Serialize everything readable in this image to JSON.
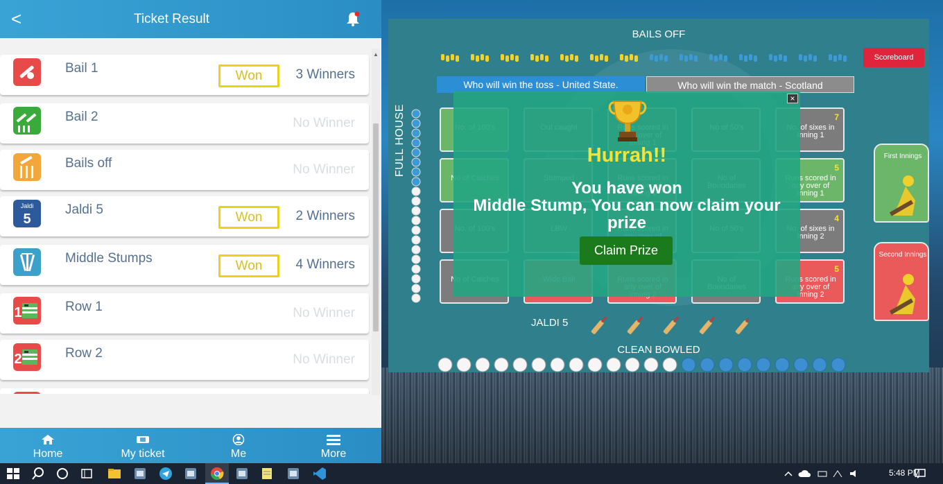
{
  "app": {
    "header_title": "Ticket Result",
    "back_glyph": "<",
    "notification_icon": "bell-icon",
    "accent_color": "#2a8ec4"
  },
  "results": [
    {
      "name": "Bail 1",
      "status": "Won",
      "winners": "3 Winners",
      "icon": "bail-icon"
    },
    {
      "name": "Bail 2",
      "status": "",
      "winners": "No Winner",
      "icon": "bails-icon"
    },
    {
      "name": "Bails off",
      "status": "",
      "winners": "No Winner",
      "icon": "bails-off-icon"
    },
    {
      "name": "Jaldi 5",
      "status": "Won",
      "winners": "2 Winners",
      "icon": "jaldi5-icon",
      "icon_text_top": "Jaldi",
      "icon_text_num": "5"
    },
    {
      "name": "Middle Stumps",
      "status": "Won",
      "winners": "4 Winners",
      "icon": "stumps-icon"
    },
    {
      "name": "Row 1",
      "status": "",
      "winners": "No Winner",
      "icon": "row1-icon",
      "icon_text_num": "1"
    },
    {
      "name": "Row 2",
      "status": "",
      "winners": "No Winner",
      "icon": "row2-icon",
      "icon_text_num": "2"
    }
  ],
  "footer": {
    "tabs": [
      {
        "label": "Home",
        "icon": "home-icon"
      },
      {
        "label": "My ticket",
        "icon": "ticket-icon"
      },
      {
        "label": "Me",
        "icon": "user-icon"
      },
      {
        "label": "More",
        "icon": "menu-icon"
      }
    ]
  },
  "game": {
    "bails_off_label": "BAILS OFF",
    "scoreboard_label": "Scoreboard",
    "toss_label": "Who will win the toss - United State.",
    "match_label": "Who will win the match - Scotland",
    "full_house_label": "FULL HOUSE",
    "jaldi_label": "JALDI 5",
    "clean_bowled_label": "CLEAN BOWLED",
    "first_innings_label": "First Innings",
    "second_innings_label": "Second Innings",
    "bail_progress": {
      "filled": 7,
      "total": 14
    },
    "full_house_progress": {
      "filled": 8,
      "total": 20
    },
    "clean_bowled_progress": {
      "filled": 13,
      "total": 22
    },
    "cards": [
      {
        "num": "",
        "label": "No. of 100's",
        "color": "green"
      },
      {
        "num": "",
        "label": "Out caught",
        "color": "gray"
      },
      {
        "num": "",
        "label": "Runs scored in any over of Inning 1",
        "color": "gray"
      },
      {
        "num": "",
        "label": "No of 50's",
        "color": "gray"
      },
      {
        "num": "7",
        "label": "No. of sixes in Inning 1",
        "color": "gray"
      },
      {
        "num": "",
        "label": "No of Catches",
        "color": "green"
      },
      {
        "num": "",
        "label": "Stumped",
        "color": "gray"
      },
      {
        "num": "",
        "label": "Runs scored in any over of Inning 1",
        "color": "gray"
      },
      {
        "num": "",
        "label": "No of Boundaries",
        "color": "gray"
      },
      {
        "num": "5",
        "label": "Runs scored in any over of Inning 1",
        "color": "green"
      },
      {
        "num": "",
        "label": "No. of 100's",
        "color": "gray"
      },
      {
        "num": "",
        "label": "LBW",
        "color": "gray"
      },
      {
        "num": "",
        "label": "Runs scored in any over of Inning 2",
        "color": "gray"
      },
      {
        "num": "",
        "label": "No of 50's",
        "color": "gray"
      },
      {
        "num": "4",
        "label": "No. of sixes in Inning 2",
        "color": "gray"
      },
      {
        "num": "",
        "label": "No of Catches",
        "color": "gray"
      },
      {
        "num": "",
        "label": "Wide Ball",
        "color": "red"
      },
      {
        "num": "",
        "label": "Runs scored in any over of Inning 2",
        "color": "red"
      },
      {
        "num": "",
        "label": "No of Boundaries",
        "color": "gray"
      },
      {
        "num": "5",
        "label": "Runs scored in any over of Inning 2",
        "color": "red"
      }
    ]
  },
  "popup": {
    "title": "Hurrah!!",
    "message_line1": "You have won",
    "message_line2": "Middle Stump, You can now claim your prize",
    "claim_label": "Claim Prize",
    "close_glyph": "×"
  },
  "taskbar": {
    "time": "5:48 PM",
    "icons": [
      "windows-start-icon",
      "search-icon",
      "cortana-icon",
      "task-view-icon",
      "file-explorer-icon",
      "app-icon",
      "telegram-icon",
      "app-icon",
      "chrome-icon",
      "app-icon",
      "notepad-icon",
      "app-icon",
      "vscode-icon"
    ]
  }
}
